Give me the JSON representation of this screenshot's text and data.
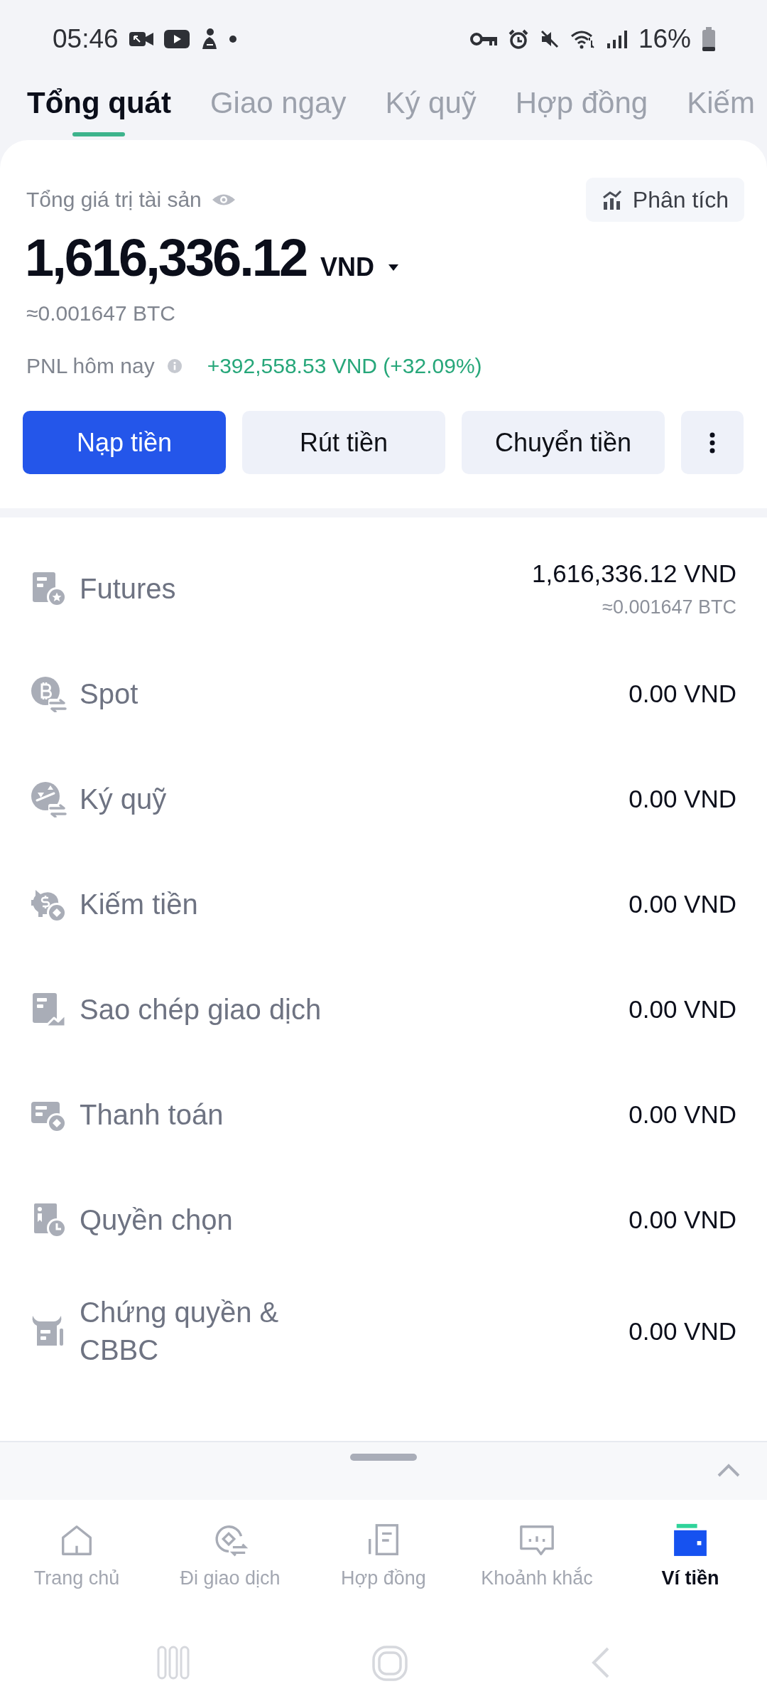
{
  "status_bar": {
    "time": "05:46",
    "battery": "16%"
  },
  "tabs": [
    {
      "label": "Tổng quát",
      "selected": true
    },
    {
      "label": "Giao ngay",
      "selected": false
    },
    {
      "label": "Ký quỹ",
      "selected": false
    },
    {
      "label": "Hợp đồng",
      "selected": false
    },
    {
      "label": "Kiếm",
      "selected": false
    }
  ],
  "summary": {
    "title": "Tổng giá trị tài sản",
    "analysis_button": "Phân tích",
    "total": "1,616,336.12",
    "currency": "VND",
    "btc_equivalent": "≈0.001647 BTC",
    "pnl_label": "PNL hôm nay",
    "pnl_value": "+392,558.53 VND (+32.09%)"
  },
  "actions": [
    {
      "kind": "primary",
      "label": "Nạp tiền"
    },
    {
      "kind": "secondary",
      "label": "Rút tiền"
    },
    {
      "kind": "secondary",
      "label": "Chuyển tiền"
    },
    {
      "kind": "more"
    }
  ],
  "accounts": [
    {
      "name": "Futures",
      "balance": "1,616,336.12 VND",
      "btc_equivalent": "≈0.001647 BTC"
    },
    {
      "name": "Spot",
      "balance": "0.00 VND"
    },
    {
      "name": "Ký quỹ",
      "balance": "0.00 VND"
    },
    {
      "name": "Kiếm tiền",
      "balance": "0.00 VND"
    },
    {
      "name": "Sao chép giao dịch",
      "balance": "0.00 VND"
    },
    {
      "name": "Thanh toán",
      "balance": "0.00 VND"
    },
    {
      "name": "Quyền chọn",
      "balance": "0.00 VND"
    },
    {
      "name": "Chứng quyền & CBBC",
      "balance": "0.00 VND"
    }
  ],
  "bottom_nav": [
    {
      "label": "Trang chủ",
      "selected": false
    },
    {
      "label": "Đi giao dịch",
      "selected": false
    },
    {
      "label": "Hợp đồng",
      "selected": false
    },
    {
      "label": "Khoảnh khắc",
      "selected": false
    },
    {
      "label": "Ví tiền",
      "selected": true
    }
  ]
}
